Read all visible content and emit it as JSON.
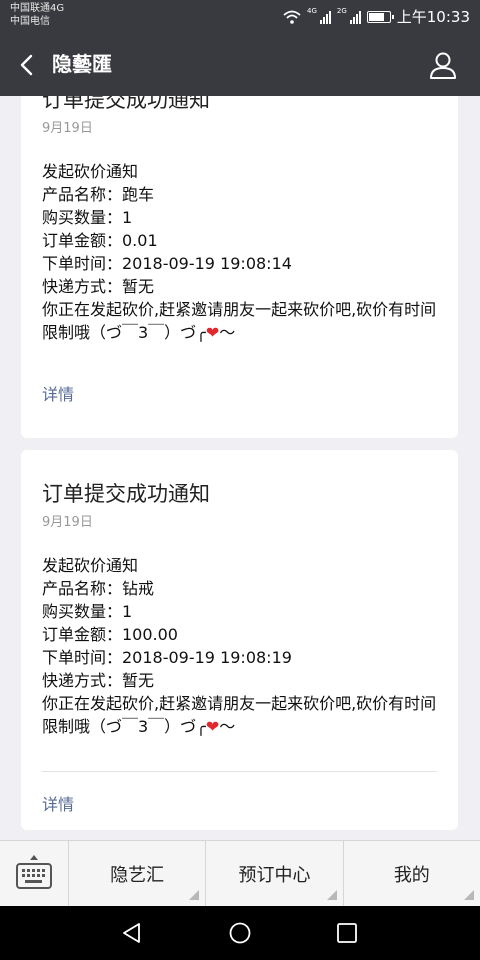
{
  "status_bar": {
    "carrier_1": "中国联通4G",
    "carrier_2": "中国电信",
    "sig_label_1": "4G",
    "sig_label_2": "2G",
    "time": "上午10:33"
  },
  "nav": {
    "title": "隐藝匯"
  },
  "cards": [
    {
      "title": "订单提交成功通知",
      "date": "9月19日",
      "lines": [
        "发起砍价通知",
        "产品名称：跑车",
        "购买数量：1",
        "订单金额：0.01",
        "下单时间：2018-09-19 19:08:14",
        "快递方式：暂无"
      ],
      "message": "你正在发起砍价,赶紧邀请朋友一起来砍价吧,砍价有时间限制哦（づ￣3￣）づ╭",
      "heart": "❤",
      "tilde": "～",
      "detail": "详情"
    },
    {
      "title": "订单提交成功通知",
      "date": "9月19日",
      "lines": [
        "发起砍价通知",
        "产品名称：钻戒",
        "购买数量：1",
        "订单金额：100.00",
        "下单时间：2018-09-19 19:08:19",
        "快递方式：暂无"
      ],
      "message": "你正在发起砍价,赶紧邀请朋友一起来砍价吧,砍价有时间限制哦（づ￣3￣）づ╭",
      "heart": "❤",
      "tilde": "～",
      "detail": "详情"
    }
  ],
  "bottom_menu": {
    "items": [
      "隐艺汇",
      "预订中心",
      "我的"
    ]
  },
  "icons": {
    "back": "back-arrow-icon",
    "profile": "person-icon",
    "keyboard": "keyboard-icon",
    "android_back": "triangle-back-icon",
    "android_home": "circle-home-icon",
    "android_recent": "square-recent-icon"
  },
  "colors": {
    "bar": "#393a3f",
    "link": "#576b95",
    "background": "#efeff4"
  }
}
